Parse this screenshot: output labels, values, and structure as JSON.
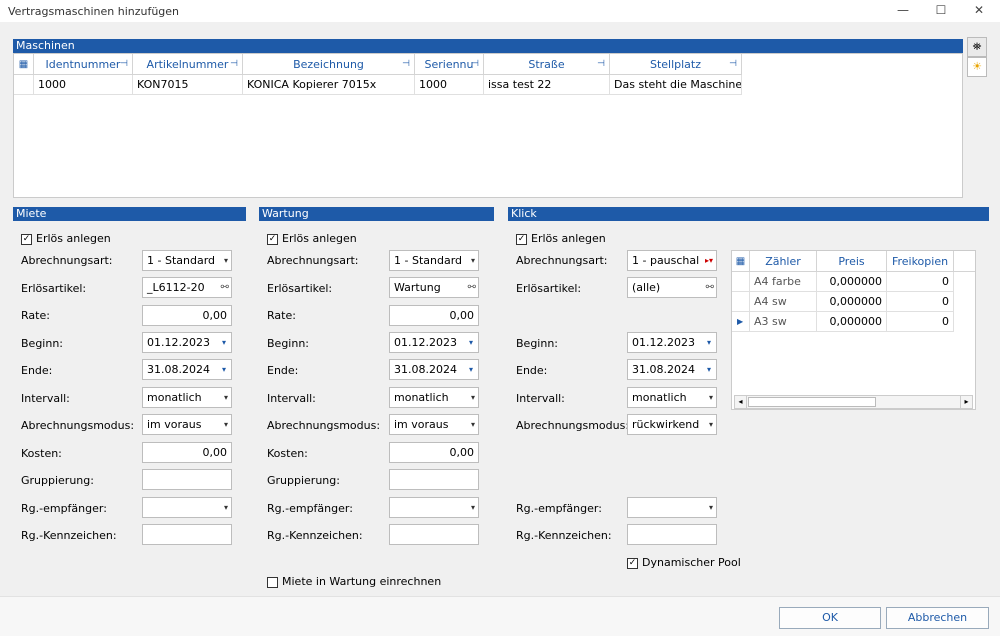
{
  "window": {
    "title": "Vertragsmaschinen hinzufügen",
    "minimize": "—",
    "maximize": "☐",
    "close": "✕"
  },
  "maschinen": {
    "header": "Maschinen",
    "columns": [
      "Identnummer",
      "Artikelnummer",
      "Bezeichnung",
      "Seriennu",
      "Straße",
      "Stellplatz"
    ],
    "row": {
      "ident": "1000",
      "artikel": "KON7015",
      "bezeichnung": "KONICA Kopierer 7015x",
      "serien": "1000",
      "strasse": "issa test 22",
      "stellplatz": "Das steht die Maschine"
    }
  },
  "side": {
    "binoculars": "⛯",
    "sun": "☀"
  },
  "miete": {
    "header": "Miete",
    "erloes_anlegen": "Erlös anlegen",
    "abrechnungsart_label": "Abrechnungsart:",
    "abrechnungsart": "1 - Standard",
    "erloesartikel_label": "Erlösartikel:",
    "erloesartikel": "_L6112-20",
    "rate_label": "Rate:",
    "rate": "0,00",
    "beginn_label": "Beginn:",
    "beginn": "01.12.2023",
    "ende_label": "Ende:",
    "ende": "31.08.2024",
    "intervall_label": "Intervall:",
    "intervall": "monatlich",
    "modus_label": "Abrechnungsmodus:",
    "modus": "im voraus",
    "kosten_label": "Kosten:",
    "kosten": "0,00",
    "gruppierung_label": "Gruppierung:",
    "empfaenger_label": "Rg.-empfänger:",
    "kennzeichen_label": "Rg.-Kennzeichen:"
  },
  "wartung": {
    "header": "Wartung",
    "erloes_anlegen": "Erlös anlegen",
    "abrechnungsart_label": "Abrechnungsart:",
    "abrechnungsart": "1 - Standard",
    "erloesartikel_label": "Erlösartikel:",
    "erloesartikel": "Wartung",
    "rate_label": "Rate:",
    "rate": "0,00",
    "beginn_label": "Beginn:",
    "beginn": "01.12.2023",
    "ende_label": "Ende:",
    "ende": "31.08.2024",
    "intervall_label": "Intervall:",
    "intervall": "monatlich",
    "modus_label": "Abrechnungsmodus:",
    "modus": "im voraus",
    "kosten_label": "Kosten:",
    "kosten": "0,00",
    "gruppierung_label": "Gruppierung:",
    "empfaenger_label": "Rg.-empfänger:",
    "kennzeichen_label": "Rg.-Kennzeichen:",
    "miete_in_wartung": "Miete in Wartung einrechnen"
  },
  "klick": {
    "header": "Klick",
    "erloes_anlegen": "Erlös anlegen",
    "abrechnungsart_label": "Abrechnungsart:",
    "abrechnungsart": "1 - pauschal",
    "erloesartikel_label": "Erlösartikel:",
    "erloesartikel": "(alle)",
    "beginn_label": "Beginn:",
    "beginn": "01.12.2023",
    "ende_label": "Ende:",
    "ende": "31.08.2024",
    "intervall_label": "Intervall:",
    "intervall": "monatlich",
    "modus_label": "Abrechnungsmodus:",
    "modus": "rückwirkend",
    "empfaenger_label": "Rg.-empfänger:",
    "kennzeichen_label": "Rg.-Kennzeichen:",
    "dynamischer_pool": "Dynamischer Pool",
    "counter_columns": [
      "Zähler",
      "Preis",
      "Freikopien"
    ],
    "counters": [
      {
        "name": "A4 farbe",
        "preis": "0,000000",
        "frei": "0"
      },
      {
        "name": "A4 sw",
        "preis": "0,000000",
        "frei": "0"
      },
      {
        "name": "A3 sw",
        "preis": "0,000000",
        "frei": "0"
      }
    ]
  },
  "buttons": {
    "ok": "OK",
    "abbrechen": "Abbrechen"
  }
}
